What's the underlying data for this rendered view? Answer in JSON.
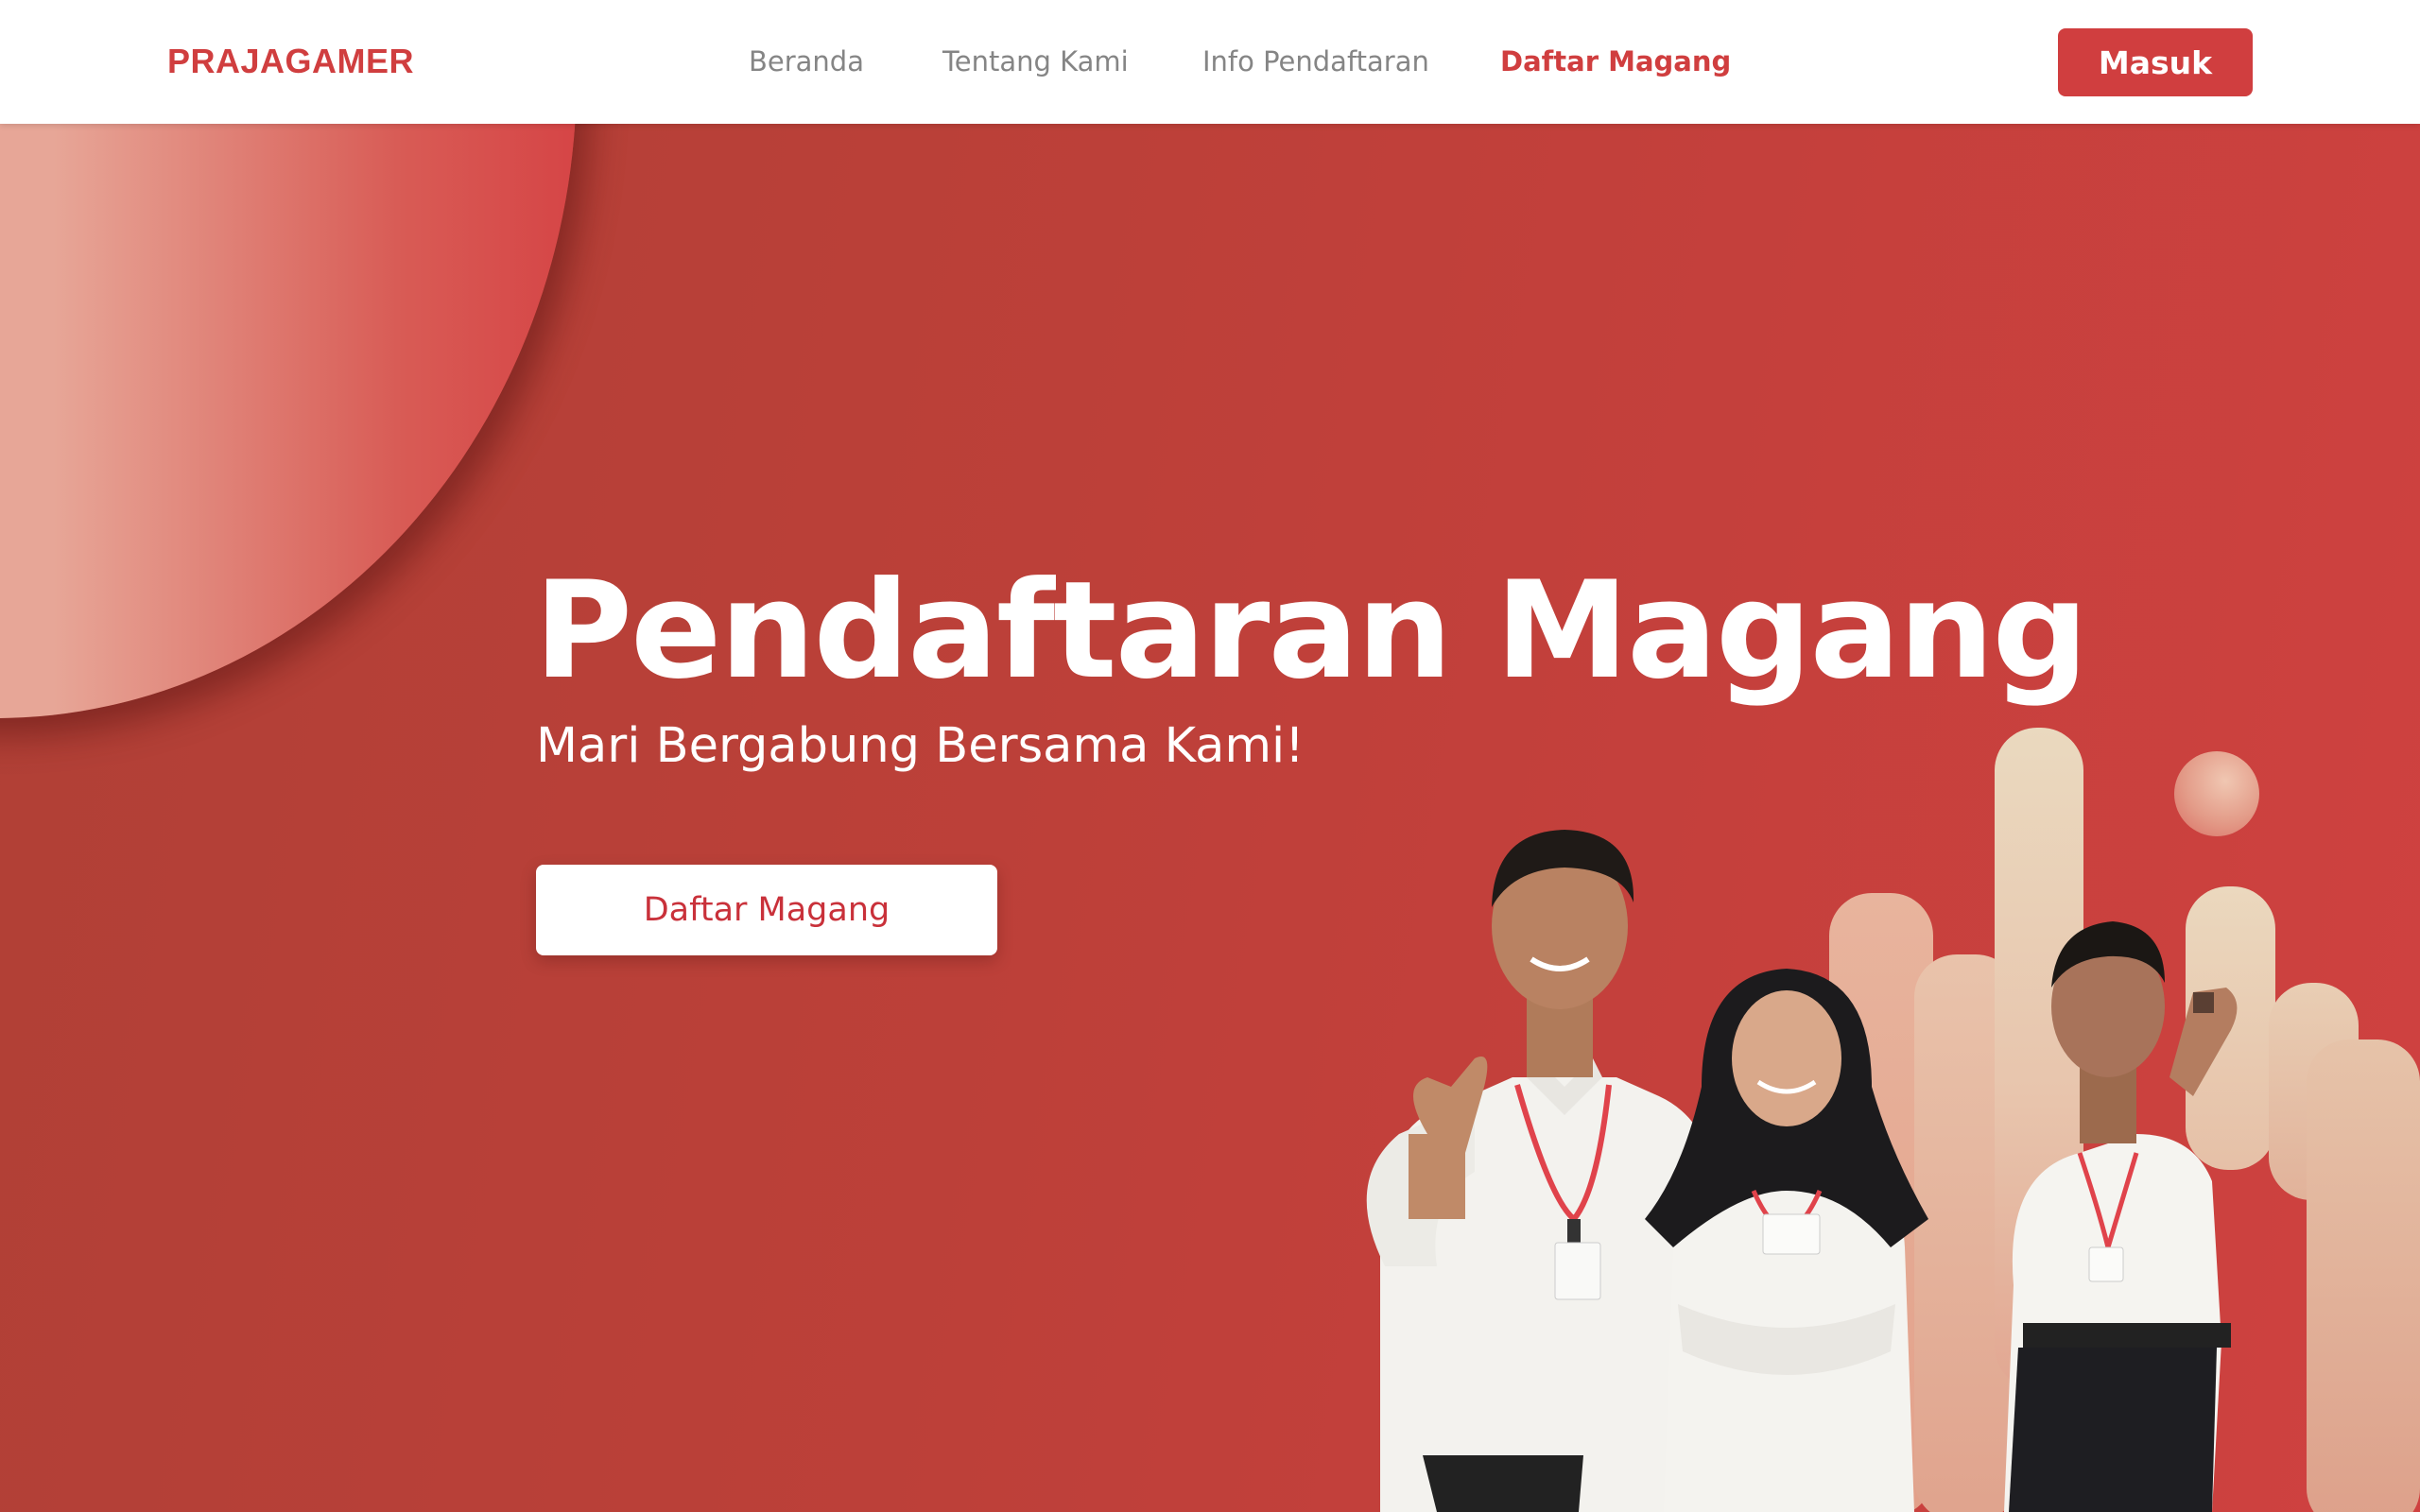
{
  "navbar": {
    "brand": "PRAJAGAMER",
    "links": [
      {
        "label": "Beranda",
        "active": false
      },
      {
        "label": "Tentang Kami",
        "active": false
      },
      {
        "label": "Info Pendaftaran",
        "active": false
      },
      {
        "label": "Daftar Magang",
        "active": true
      }
    ],
    "login_label": "Masuk"
  },
  "hero": {
    "title": "Pendaftaran Magang",
    "subtitle": "Mari Bergabung Bersama Kami!",
    "cta_label": "Daftar Magang"
  },
  "colors": {
    "brand_red": "#d03e3f",
    "hero_bg_start": "#b04036",
    "hero_bg_end": "#cf4140",
    "nav_text": "#858585",
    "white": "#ffffff"
  },
  "icons": {
    "photo": "students-group-photo"
  }
}
